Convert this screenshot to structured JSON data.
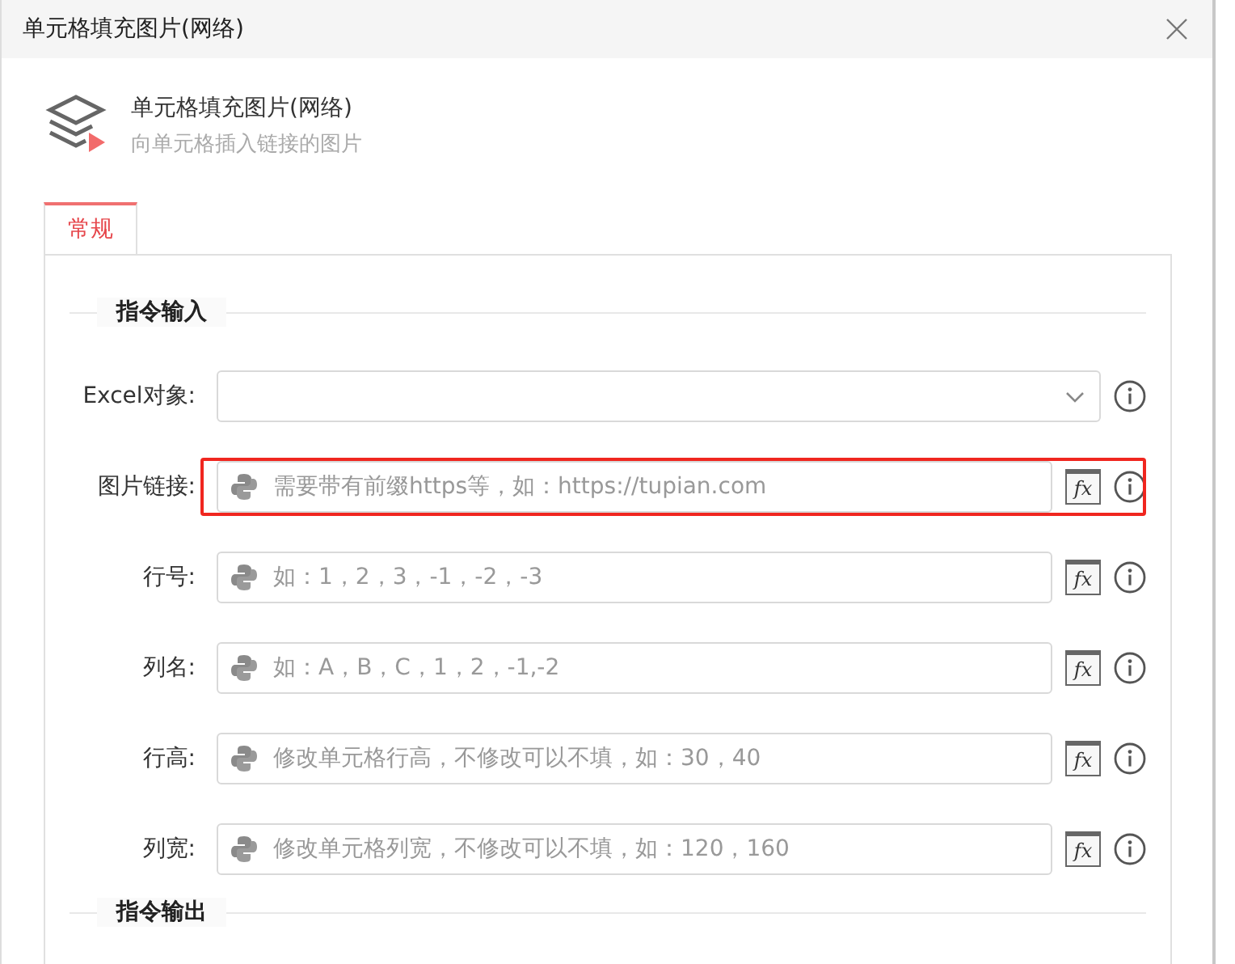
{
  "window": {
    "title": "单元格填充图片(网络)"
  },
  "header": {
    "title": "单元格填充图片(网络)",
    "subtitle": "向单元格插入链接的图片"
  },
  "tabs": [
    {
      "label": "常规",
      "selected": true
    }
  ],
  "sections": [
    {
      "title": "指令输入",
      "fields": [
        {
          "kind": "select",
          "label": "Excel对象:",
          "highlighted": false
        },
        {
          "kind": "python",
          "label": "图片链接:",
          "placeholder": "需要带有前缀https等，如：https://tupian.com",
          "formula": "fx",
          "highlighted": true
        },
        {
          "kind": "python",
          "label": "行号:",
          "placeholder": "如：1，2，3，-1，-2，-3",
          "formula": "fx",
          "highlighted": false
        },
        {
          "kind": "python",
          "label": "列名:",
          "placeholder": "如：A，B，C，1，2，-1,-2",
          "formula": "fx",
          "highlighted": false
        },
        {
          "kind": "python",
          "label": "行高:",
          "placeholder": "修改单元格行高，不修改可以不填，如：30，40",
          "formula": "fx",
          "highlighted": false
        },
        {
          "kind": "python",
          "label": "列宽:",
          "placeholder": "修改单元格列宽，不修改可以不填，如：120，160",
          "formula": "fx",
          "highlighted": false
        }
      ]
    },
    {
      "title": "指令输出"
    }
  ]
}
